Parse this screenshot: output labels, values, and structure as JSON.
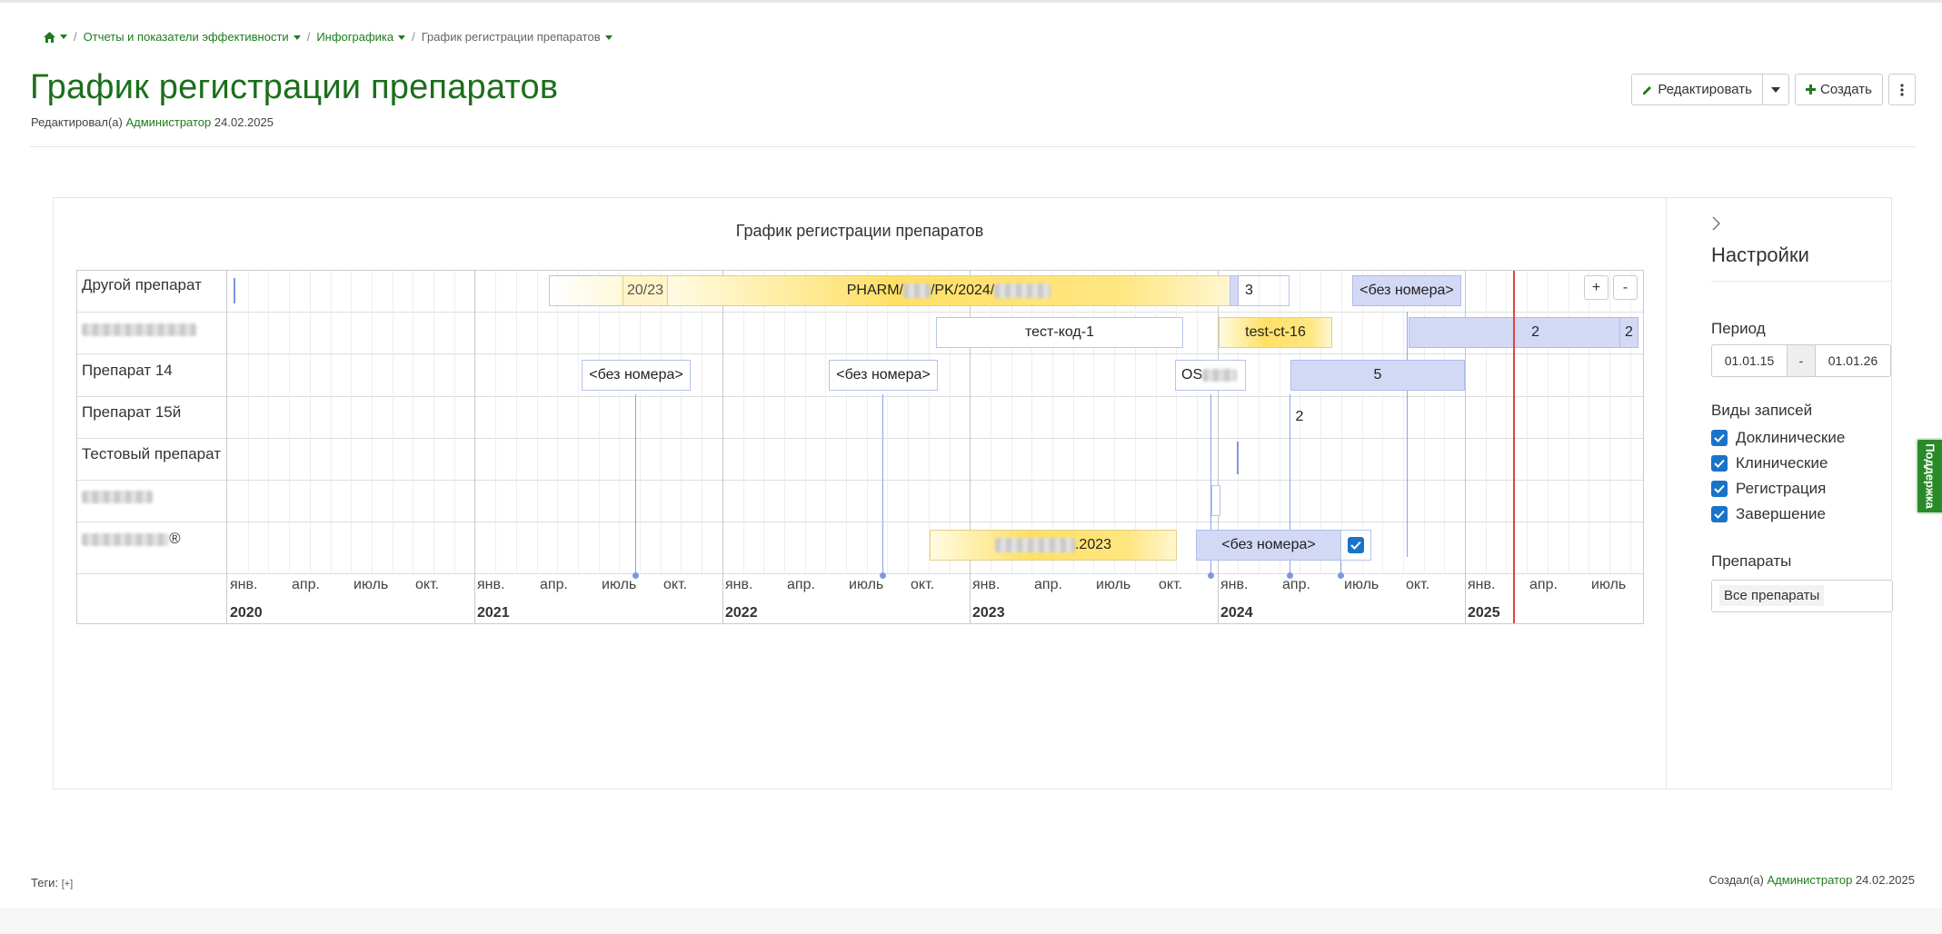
{
  "breadcrumb": {
    "items": [
      "Отчеты и показатели эффективности",
      "Инфографика"
    ],
    "current": "График регистрации препаратов"
  },
  "page": {
    "title": "График регистрации препаратов",
    "edited_prefix": "Редактировал(а)",
    "edited_user": "Администратор",
    "edited_date": "24.02.2025"
  },
  "toolbar": {
    "edit_label": "Редактировать",
    "create_label": "Создать"
  },
  "chart": {
    "title": "График регистрации препаратов",
    "rows": [
      "Другой препарат",
      "",
      "Препарат 14",
      "Препарат 15й",
      "Тестовый препарат",
      "",
      "®"
    ],
    "months": [
      "янв.",
      "апр.",
      "июль",
      "окт."
    ],
    "years": [
      "2020",
      "2021",
      "2022",
      "2023",
      "2024",
      "2025"
    ],
    "bars": {
      "r0_a": "20/23",
      "r0_b": "PHARM/",
      "r0_b2": "/PK/2024/",
      "r0_c": "3",
      "r0_d": "<без номера>",
      "r1_a": "тест-код-1",
      "r1_b": "test-ct-16",
      "r1_c": "2",
      "r1_d": "2",
      "r2_a": "<без номера>",
      "r2_b": "<без номера>",
      "r2_c": "OS",
      "r2_d": "5",
      "r3_a": "2",
      "r6_a": ".2023",
      "r6_b": "<без номера>"
    },
    "zoom_in": "+",
    "zoom_out": "-"
  },
  "settings": {
    "title": "Настройки",
    "period_label": "Период",
    "period_from": "01.01.15",
    "period_sep": "-",
    "period_to": "01.01.26",
    "types_label": "Виды записей",
    "types": [
      "Доклинические",
      "Клинические",
      "Регистрация",
      "Завершение"
    ],
    "drugs_label": "Препараты",
    "drugs_value": "Все препараты"
  },
  "support": "Поддержка",
  "footer": {
    "tags_label": "Теги:",
    "tags_add": "[+]",
    "created_prefix": "Создал(а)",
    "created_user": "Администратор",
    "created_date": "24.02.2025"
  },
  "colors": {
    "brand_green": "#1b6f1b",
    "today_line": "#e04444",
    "bar_blue": "#d3d9f5",
    "bar_yellow": "#ffe066"
  }
}
